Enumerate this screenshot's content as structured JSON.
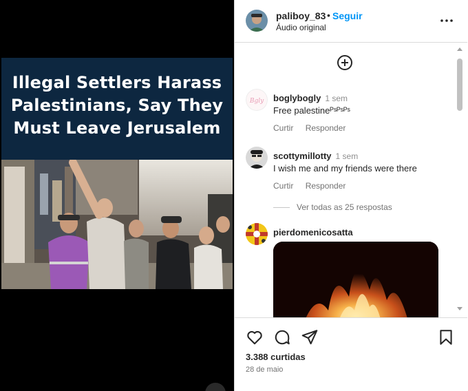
{
  "video": {
    "title_lines": [
      "Illegal Settlers Harass",
      "Palestinians, Say They",
      "Must Leave Jerusalem"
    ]
  },
  "header": {
    "username": "paliboy_83",
    "separator": "•",
    "follow_label": "Seguir",
    "audio_label": "Áudio original"
  },
  "comments": [
    {
      "username": "boglybogly",
      "time": "1 sem",
      "text": "Free palestineᴾˢᴾˢᴾˢ",
      "reply_label": "Curtir",
      "answer_label": "Responder"
    },
    {
      "username": "scottymillotty",
      "time": "1 sem",
      "text": "I wish me and my friends were there",
      "reply_label": "Curtir",
      "answer_label": "Responder"
    },
    {
      "username": "pierdomenicosatta"
    }
  ],
  "view_replies_label": "Ver todas as 25 respostas",
  "footer": {
    "likes": "3.388 curtidas",
    "date": "28 de maio"
  },
  "colors": {
    "accent": "#0095f6",
    "title_band": "#0d2740",
    "muted": "#737373"
  },
  "icons": [
    "plus-circle-icon",
    "more-icon",
    "heart-icon",
    "comment-icon",
    "share-icon",
    "bookmark-icon"
  ]
}
